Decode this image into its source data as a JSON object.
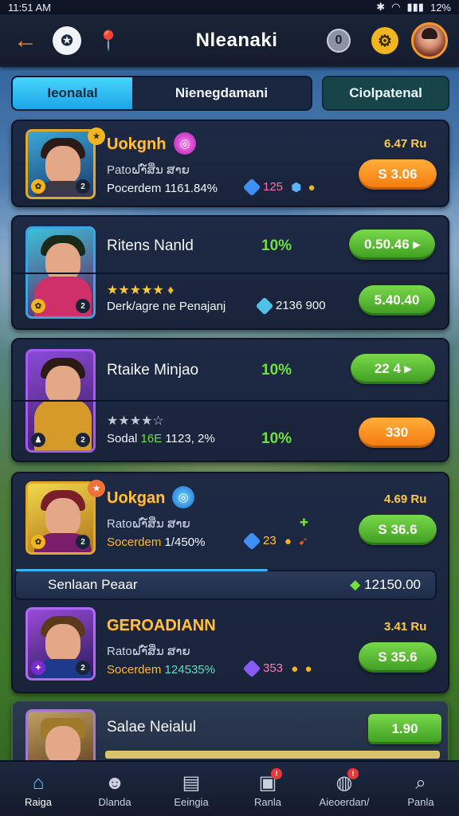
{
  "status_bar": {
    "time": "11:51 AM",
    "battery": "12%"
  },
  "header": {
    "title": "Nleanaki",
    "coin_icon_label": "0"
  },
  "tabs": {
    "tab1": "Ieonalal",
    "tab2": "Nienegdamani",
    "tab3": "Ciolpatenal"
  },
  "cards": [
    {
      "name": "Uokgnh",
      "subtitle": "Patoຝາ໌ສິ່ນ ສາຍ",
      "stat_label": "Pocerdem",
      "stat_value": "1161.84%",
      "price": "6.47 Ru",
      "res1": "125",
      "res2": "",
      "button": "S 3.06"
    },
    {
      "name": "Ritens Nanld",
      "pct": "10%",
      "button_top": "0.50.46 ▸",
      "desc": "Derk/agre ne Penajanj",
      "res": "2136 900",
      "button_bottom": "5.40.40"
    },
    {
      "name": "Rtaike Minjao",
      "pct_top": "10%",
      "button_top": "22 4 ▸",
      "stat_label": "Sodal",
      "stat_green": "16E",
      "stat_value": "1123, 2%",
      "pct_bottom": "10%",
      "button_bottom": "330"
    },
    {
      "name": "Uokgan",
      "subtitle": "Ratoຝາ໌ສິ່ນ ສາຍ",
      "stat_label": "Socerdem",
      "stat_value": "1/450%",
      "price": "4.69 Ru",
      "res1": "23",
      "button": "S 36.6"
    },
    {
      "name": "GEROADIANN",
      "subtitle": "Ratoຝາ໌ສິ່ນ ສາຍ",
      "stat_label": "Socerdem",
      "stat_value": "124535%",
      "price": "3.41 Ru",
      "res1": "353",
      "button": "S 35.6"
    },
    {
      "name": "Salae Neialul",
      "button": "1.90"
    }
  ],
  "section_bar": {
    "label": "Senlaan Peaar",
    "value": "12150.00"
  },
  "bottom_nav": [
    {
      "label": "Raiga"
    },
    {
      "label": "Dlanda"
    },
    {
      "label": "Eeingia"
    },
    {
      "label": "Ranla"
    },
    {
      "label": "Aieoerdan/"
    },
    {
      "label": "Panla"
    }
  ],
  "colors": {
    "accent_blue": "#1aa6e8",
    "gold": "#ffc042",
    "green": "#6fe23d",
    "orange": "#f3780e"
  }
}
